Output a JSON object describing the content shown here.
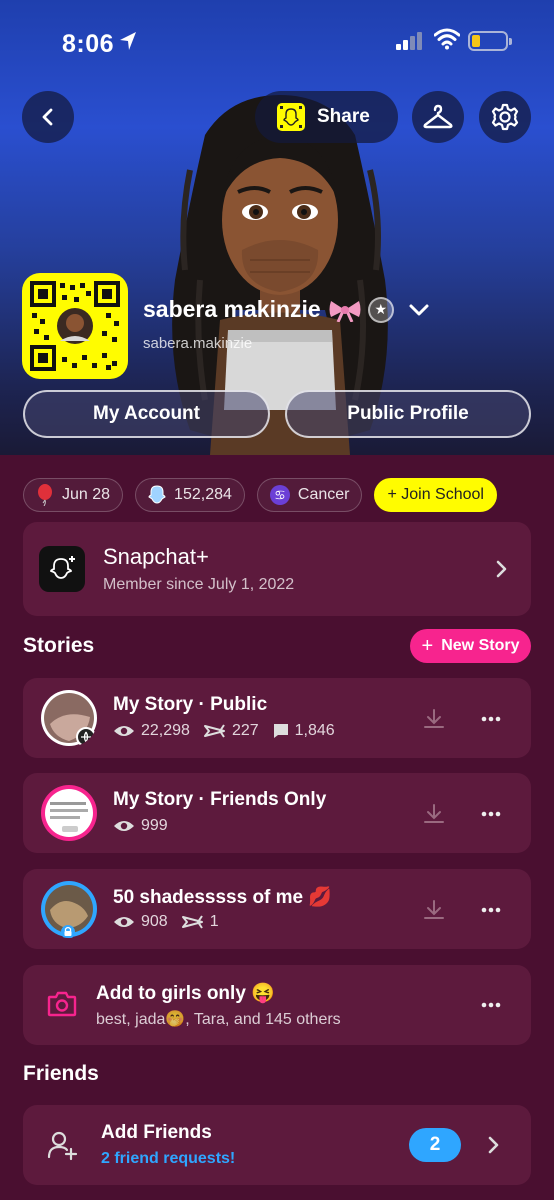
{
  "status_bar": {
    "time": "8:06"
  },
  "header": {
    "share_label": "Share"
  },
  "profile": {
    "display_name": "sabera makinzie",
    "username": "sabera.makinzie",
    "my_account_label": "My Account",
    "public_profile_label": "Public Profile"
  },
  "chips": {
    "birthday": "Jun 28",
    "score": "152,284",
    "zodiac": "Cancer",
    "school": "+ Join School"
  },
  "snapchat_plus": {
    "title": "Snapchat+",
    "subtitle": "Member since July 1, 2022"
  },
  "stories": {
    "section_title": "Stories",
    "new_story_label": "New Story",
    "items": [
      {
        "title": "My Story · Public",
        "views": "22,298",
        "screenshots": "227",
        "replies": "1,846"
      },
      {
        "title": "My Story · Friends Only",
        "views": "999"
      },
      {
        "title": "50 shadesssss of me 💋",
        "views": "908",
        "screenshots": "1"
      },
      {
        "title": "Add to girls only 😝",
        "subtitle": "best, jada🤭, Tara, and 145 others"
      }
    ]
  },
  "friends": {
    "section_title": "Friends",
    "add_friends_title": "Add Friends",
    "requests_text": "2 friend requests!",
    "requests_count": "2"
  },
  "colors": {
    "background": "#4a0f30",
    "card": "#5d1a3d",
    "snap_yellow": "#fffc00",
    "accent_pink": "#f7248e",
    "link_blue": "#2fa6ff"
  }
}
